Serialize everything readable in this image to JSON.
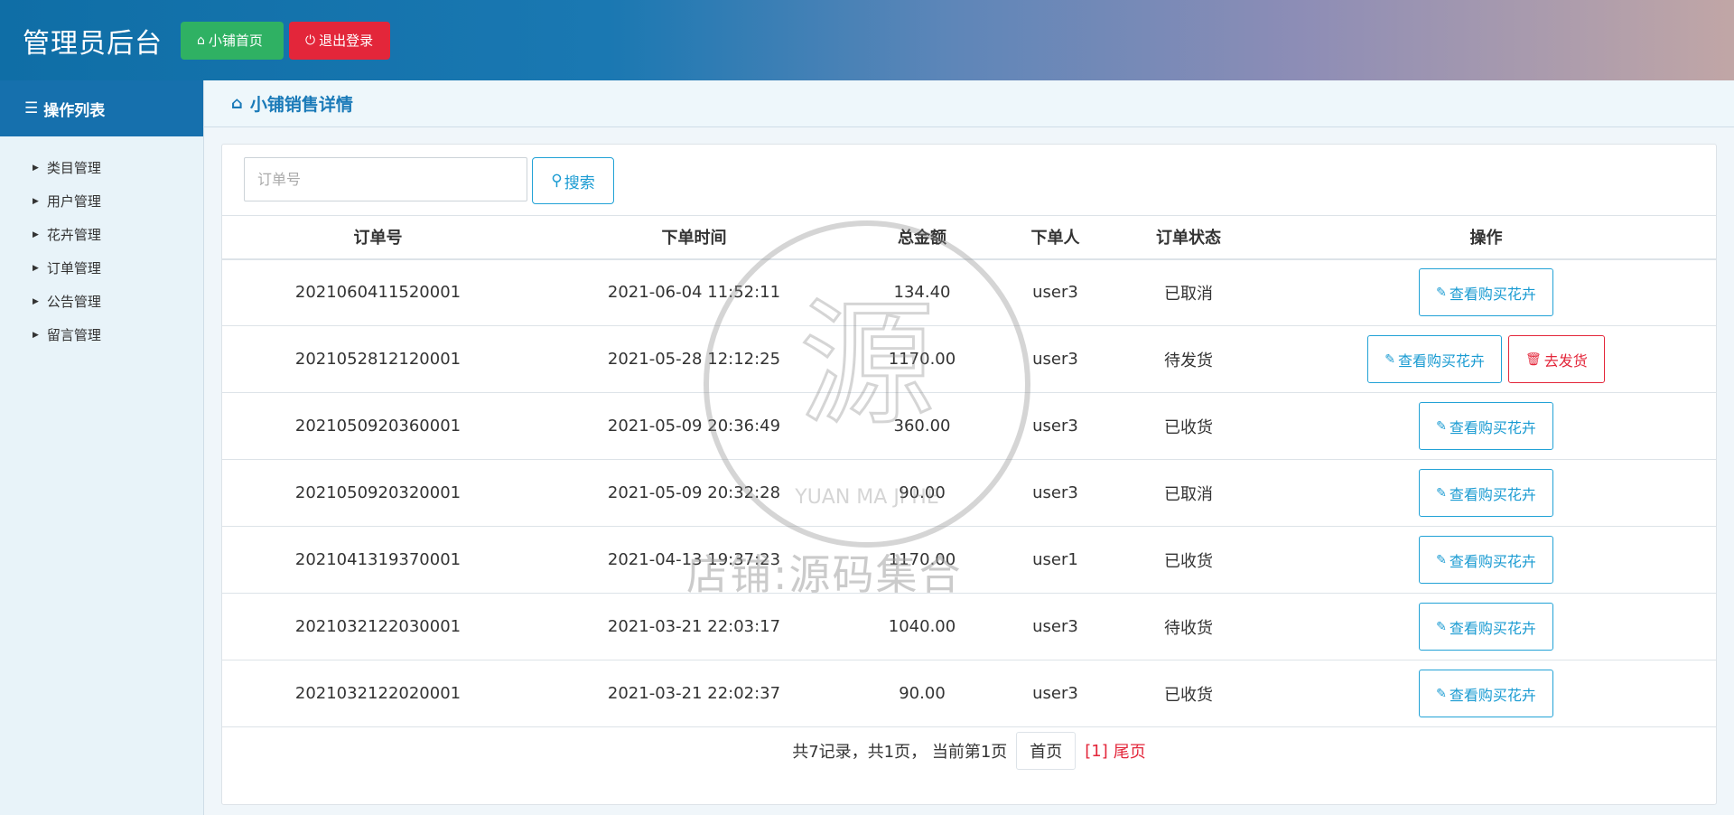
{
  "header": {
    "title": "管理员后台",
    "home_label": "小铺首页",
    "logout_label": "退出登录"
  },
  "sidebar": {
    "title": "操作列表",
    "items": [
      {
        "label": "类目管理"
      },
      {
        "label": "用户管理"
      },
      {
        "label": "花卉管理"
      },
      {
        "label": "订单管理"
      },
      {
        "label": "公告管理"
      },
      {
        "label": "留言管理"
      }
    ]
  },
  "page": {
    "title": "小铺销售详情"
  },
  "search": {
    "placeholder": "订单号",
    "button_label": "搜索"
  },
  "table": {
    "columns": [
      "订单号",
      "下单时间",
      "总金额",
      "下单人",
      "订单状态",
      "操作"
    ],
    "rows": [
      {
        "id": "2021060411520001",
        "time": "2021-06-04 11:52:11",
        "amount": "134.40",
        "user": "user3",
        "status": "已取消",
        "view": "查看购买花卉"
      },
      {
        "id": "2021052812120001",
        "time": "2021-05-28 12:12:25",
        "amount": "1170.00",
        "user": "user3",
        "status": "待发货",
        "view": "查看购买花卉",
        "ship": "去发货"
      },
      {
        "id": "2021050920360001",
        "time": "2021-05-09 20:36:49",
        "amount": "360.00",
        "user": "user3",
        "status": "已收货",
        "view": "查看购买花卉"
      },
      {
        "id": "2021050920320001",
        "time": "2021-05-09 20:32:28",
        "amount": "90.00",
        "user": "user3",
        "status": "已取消",
        "view": "查看购买花卉"
      },
      {
        "id": "2021041319370001",
        "time": "2021-04-13 19:37:23",
        "amount": "1170.00",
        "user": "user1",
        "status": "已收货",
        "view": "查看购买花卉"
      },
      {
        "id": "2021032122030001",
        "time": "2021-03-21 22:03:17",
        "amount": "1040.00",
        "user": "user3",
        "status": "待收货",
        "view": "查看购买花卉"
      },
      {
        "id": "2021032122020001",
        "time": "2021-03-21 22:02:37",
        "amount": "90.00",
        "user": "user3",
        "status": "已收货",
        "view": "查看购买花卉"
      }
    ]
  },
  "pager": {
    "summary": "共7记录，共1页， 当前第1页",
    "first_label": "首页",
    "current_label": "[1]",
    "last_label": "尾页"
  },
  "watermark": {
    "text": "店铺:源码集合",
    "sub": "YUAN MA JI HE"
  },
  "colors": {
    "accent": "#1a9bd2",
    "danger": "#e3263a",
    "success": "#2fb163",
    "header_start": "#0f6ea6",
    "header_end": "#c1a6a6"
  }
}
